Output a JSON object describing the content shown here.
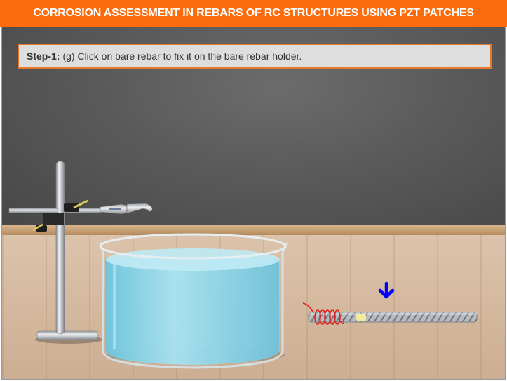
{
  "title": "CORROSION ASSESSMENT IN REBARS OF RC STRUCTURES USING PZT PATCHES",
  "instruction": {
    "step_label": "Step-1:",
    "text": "(g) Click on bare rebar to fix it on the bare rebar holder."
  },
  "colors": {
    "header": "#fb6c0c",
    "instruction_border": "#e8782a",
    "wall": "#5a5a5a",
    "water": "#8fd6ea",
    "arrow": "#0000ff",
    "wire": "#e02020"
  },
  "icons": {
    "pointer": "down-arrow-icon"
  }
}
